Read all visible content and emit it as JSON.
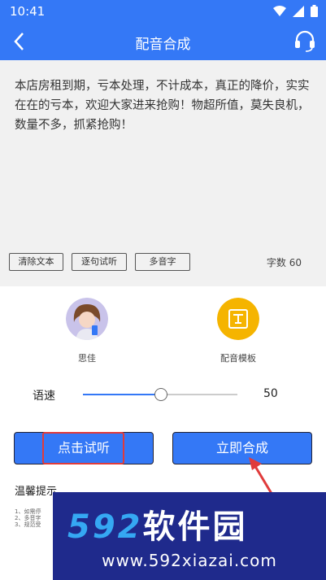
{
  "status": {
    "time": "10:41"
  },
  "header": {
    "title": "配音合成"
  },
  "editor": {
    "text": "本店房租到期，亏本处理，不计成本，真正的降价，实实在在的亏本，欢迎大家进来抢购！物超所值，莫失良机，数量不多，抓紧抢购！",
    "clear_label": "清除文本",
    "listen_sentence_label": "逐句试听",
    "polyphone_label": "多音字",
    "word_count": "字数 60"
  },
  "voices": [
    {
      "name": "思佳"
    },
    {
      "name": "配音模板"
    }
  ],
  "speed": {
    "label": "语速",
    "value": "50",
    "fraction": 0.5
  },
  "actions": {
    "preview_label": "点击试听",
    "synthesize_label": "立即合成"
  },
  "tips": {
    "title": "温馨提示",
    "lines": [
      "1、如需停",
      "2、多音字",
      "3、规范受"
    ]
  },
  "watermark": {
    "logo_num": "592",
    "logo_cn": "软件园",
    "url": "www.592xiazai.com"
  },
  "colors": {
    "primary": "#3478f6",
    "highlight": "#e03b3b",
    "watermark_bg": "#1f2a8c"
  }
}
